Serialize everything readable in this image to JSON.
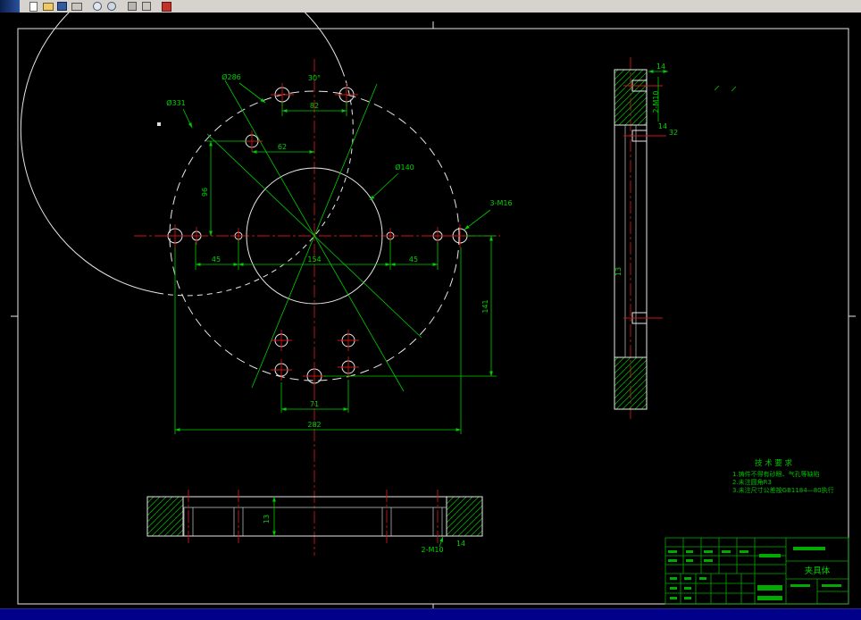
{
  "toolbar": {
    "icons": [
      "new-icon",
      "open-icon",
      "save-icon",
      "print-icon",
      "preview-icon",
      "zoom-icon",
      "cut-icon",
      "copy-icon",
      "help-icon"
    ]
  },
  "front_view": {
    "dims": {
      "dia_outer": "Ø331",
      "dia_bolt": "Ø286",
      "dia_inner": "Ø140",
      "angle": "30°",
      "span_top": "82",
      "span_mid": "62",
      "left_45": "45",
      "mid_154": "154",
      "right_45": "45",
      "height_96": "96",
      "height_141": "141",
      "span_71": "71",
      "total_282": "282",
      "thread": "3-M16"
    }
  },
  "side_view": {
    "dims": {
      "top_14": "14",
      "thread": "2-M10",
      "step_14": "14",
      "width_32": "32",
      "thick_13": "13"
    }
  },
  "bottom_view": {
    "dims": {
      "thick_13": "13",
      "thread": "2-M10",
      "depth_14": "14"
    }
  },
  "notes": {
    "title": "技 术 要 求",
    "line1": "1.铸件不得有砂眼、气孔等缺陷",
    "line2": "2.未注圆角R3",
    "line3": "3.未注尺寸公差按GB1184—80执行"
  },
  "title_block": {
    "part_name": "夹具体"
  }
}
